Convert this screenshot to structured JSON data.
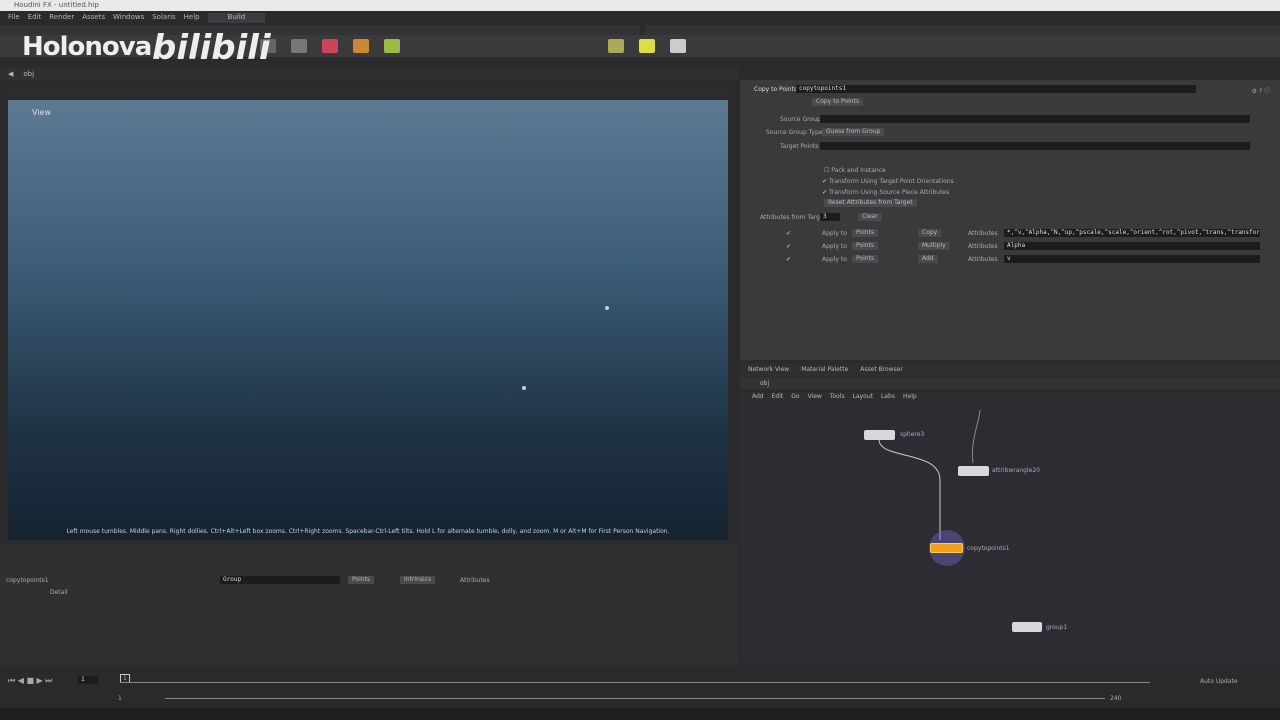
{
  "window": {
    "title": "Houdini FX - untitled.hip"
  },
  "watermark": {
    "brand": "Holonova",
    "site": "bilibili"
  },
  "menu": [
    "File",
    "Edit",
    "Render",
    "Assets",
    "Windows",
    "Solaris",
    "Help"
  ],
  "desktop": "Build",
  "pane_path": "obj",
  "viewport": {
    "label": "View",
    "hint": "Left mouse tumbles. Middle pans. Right dollies. Ctrl+Alt+Left box zooms. Ctrl+Right zooms. Spacebar-Ctrl-Left tilts. Hold L for alternate tumble, dolly, and zoom. M or Alt+M for First Person Navigation.",
    "background_top": "#5d7a93",
    "background_bottom": "#15222f"
  },
  "params": {
    "header_type": "Copy to Points",
    "header_name": "copytopoints1",
    "tab": "Copy to Points",
    "source_group_label": "Source Group",
    "source_group_type_label": "Source Group Type",
    "source_group_type_value": "Guess from Group",
    "target_points_label": "Target Points",
    "pack_label": "Pack and Instance",
    "transform_label": "Transform Using Target Point Orientations",
    "transform_piece_label": "Transform Using Source Piece Attributes",
    "attr_button": "Reset Attributes from Target",
    "num_attr_label": "Attributes from Target",
    "num_attr_value": "3",
    "clear_label": "Clear",
    "rows": [
      {
        "apply": "Apply to",
        "target": "Points",
        "op": "Copy",
        "attr_label": "Attributes",
        "attr": "*,^v,^Alpha,^N,^up,^pscale,^scale,^orient,^rot,^pivot,^trans,^transform"
      },
      {
        "apply": "Apply to",
        "target": "Points",
        "op": "Multiply",
        "attr_label": "Attributes",
        "attr": "Alpha"
      },
      {
        "apply": "Apply to",
        "target": "Points",
        "op": "Add",
        "attr_label": "Attributes",
        "attr": "v"
      }
    ]
  },
  "network": {
    "tabs": [
      "Network View",
      "Material Palette",
      "Asset Browser"
    ],
    "path": "obj",
    "menu": [
      "Add",
      "Edit",
      "Go",
      "View",
      "Tools",
      "Layout",
      "Labs",
      "Help"
    ],
    "nodes": [
      {
        "name": "sphere3"
      },
      {
        "name": "attribwrangle20"
      },
      {
        "name": "copytopoints1",
        "color": "#f0a020"
      },
      {
        "name": "group1"
      }
    ]
  },
  "spreadsheet": {
    "node": "copytopoints1",
    "group_label": "Group",
    "view": "Points",
    "intrinsics": "Intrinsics",
    "attributes": "Attributes",
    "col": "Detail"
  },
  "timeline": {
    "frame": "1",
    "start": "1",
    "end": "240",
    "current_marker": "1",
    "realtime": "Auto Update"
  }
}
